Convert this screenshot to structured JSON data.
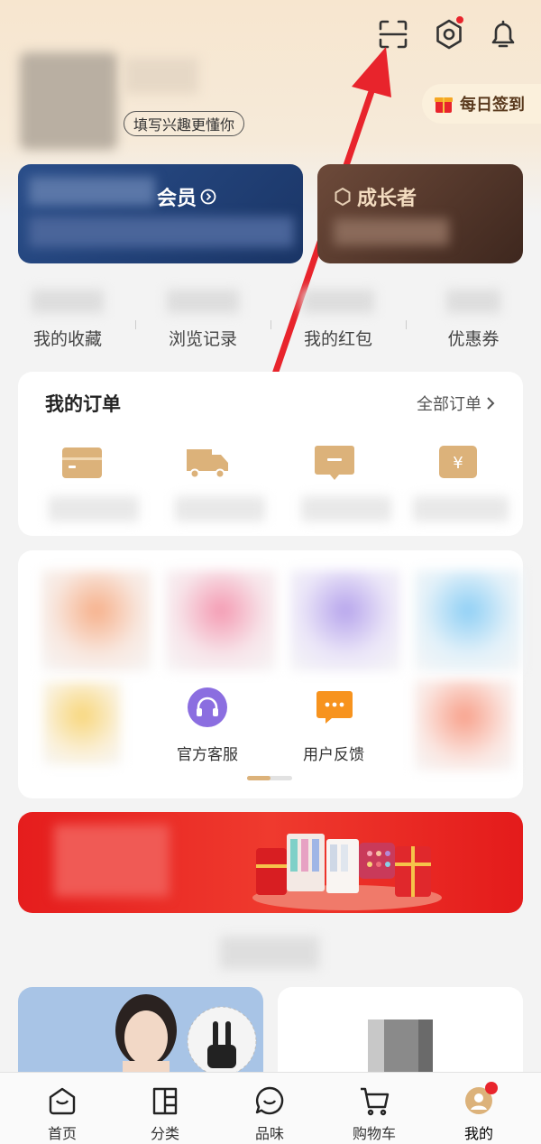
{
  "colors": {
    "accent": "#e8242c",
    "gold": "#d9b07a",
    "vip": "#1f3d74",
    "growth": "#5c3a2e"
  },
  "header": {
    "interest_chip": "填写兴趣更懂你",
    "checkin_label": "每日签到",
    "icons": [
      "scan-icon",
      "settings-icon",
      "bell-icon"
    ]
  },
  "membership": {
    "member_label": "会员",
    "growth_label": "成长者"
  },
  "quick_links": [
    {
      "label": "我的收藏"
    },
    {
      "label": "浏览记录"
    },
    {
      "label": "我的红包"
    },
    {
      "label": "优惠券"
    }
  ],
  "orders": {
    "title": "我的订单",
    "all_label": "全部订单",
    "icons": [
      "pending-payment-icon",
      "shipping-truck-icon",
      "pending-review-icon",
      "refund-yen-icon"
    ]
  },
  "services": {
    "customer_service": "官方客服",
    "feedback": "用户反馈"
  },
  "tabbar": [
    {
      "label": "首页",
      "icon": "home-icon"
    },
    {
      "label": "分类",
      "icon": "category-icon"
    },
    {
      "label": "品味",
      "icon": "taste-icon"
    },
    {
      "label": "购物车",
      "icon": "cart-icon"
    },
    {
      "label": "我的",
      "icon": "profile-icon"
    }
  ]
}
